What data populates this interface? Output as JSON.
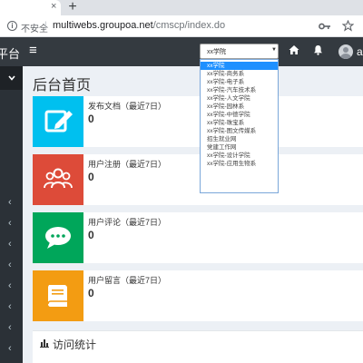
{
  "browser": {
    "tab_close": "×",
    "new_tab": "+",
    "back": "←",
    "forward": "→",
    "reload": "C",
    "security_label": "不安全",
    "separator": "|",
    "url_host": "multiwebs.groupoa.net",
    "url_path": "/cmscp/index.do"
  },
  "topbar": {
    "brand_fragment": "平台",
    "menu_icon": "≡",
    "username_fragment": "a"
  },
  "sidebar": {
    "chevrons": [
      "‹",
      "‹",
      "‹",
      "‹",
      "‹",
      "‹",
      "‹",
      "‹"
    ]
  },
  "page": {
    "title": "后台首页"
  },
  "cards": [
    {
      "label": "发布文档（最近7日）",
      "value": "0",
      "color": "#00c0ef",
      "icon": "edit-icon"
    },
    {
      "label": "用户注册（最近7日）",
      "value": "0",
      "color": "#dd4b39",
      "icon": "users-icon"
    },
    {
      "label": "用户评论（最近7日）",
      "value": "0",
      "color": "#00a65a",
      "icon": "comment-icon"
    },
    {
      "label": "用户留言（最近7日）",
      "value": "0",
      "color": "#f39c12",
      "icon": "book-icon"
    }
  ],
  "stats": {
    "title": "访问统计"
  },
  "site_select": {
    "value": "xx学院",
    "caret": "▼",
    "options": [
      "xx学院",
      "xx学院-商务系",
      "xx学院-电子系",
      "xx学院-汽车技术系",
      "xx学院-人文学院",
      "xx学院-园林系",
      "xx学院-中德学院",
      "xx学院-珠宝系",
      "xx学院-图文传媒系",
      "招生就业网",
      "党建工作网",
      "xx学院-设计学院",
      "xx学院-应用生物系"
    ],
    "selected_index": 0
  },
  "colors": {
    "topbar": "#343a40",
    "sidebar": "#2b3137",
    "content_bg": "#ecf0f5",
    "option_highlight": "#1e90ff"
  }
}
